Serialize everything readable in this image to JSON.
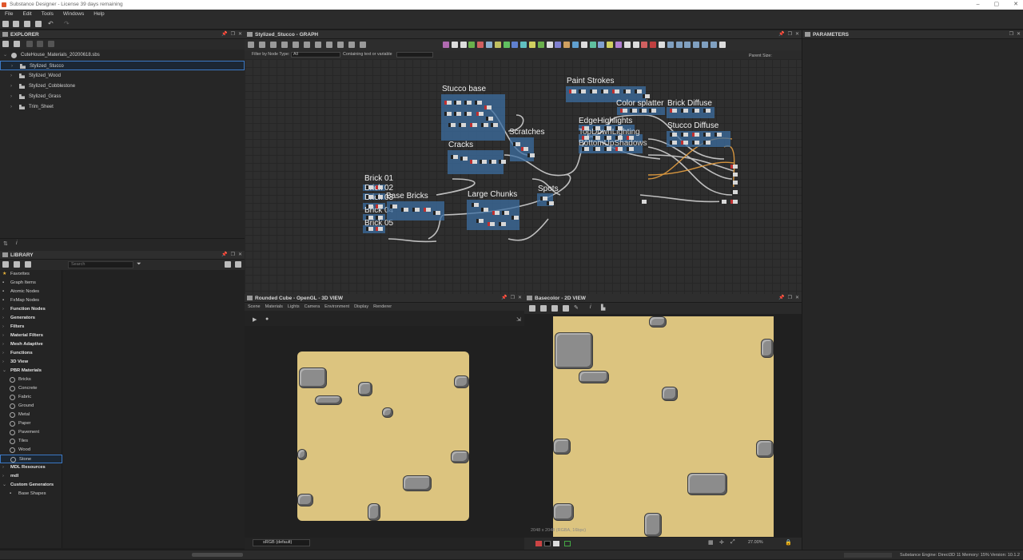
{
  "window": {
    "title": "Substance Designer - License 39 days remaining"
  },
  "menu": [
    "File",
    "Edit",
    "Tools",
    "Windows",
    "Help"
  ],
  "explorer": {
    "title": "EXPLORER",
    "file": "CuteHouse_Materials_20200618.sbs",
    "graphs": [
      "Stylized_Stucco",
      "Stylized_Wood",
      "Stylized_Cobblestone",
      "Stylized_Grass",
      "Trim_Sheet"
    ],
    "selected": "Stylized_Stucco"
  },
  "library": {
    "title": "LIBRARY",
    "search_placeholder": "Search",
    "items": [
      {
        "label": "Favorites",
        "kind": "star"
      },
      {
        "label": "Graph Items",
        "kind": "icon"
      },
      {
        "label": "Atomic Nodes",
        "kind": "icon"
      },
      {
        "label": "FxMap Nodes",
        "kind": "icon"
      },
      {
        "label": "Function Nodes",
        "kind": "bold"
      },
      {
        "label": "Generators",
        "kind": "bold"
      },
      {
        "label": "Filters",
        "kind": "bold"
      },
      {
        "label": "Material Filters",
        "kind": "bold"
      },
      {
        "label": "Mesh Adaptive",
        "kind": "bold"
      },
      {
        "label": "Functions",
        "kind": "bold"
      },
      {
        "label": "3D View",
        "kind": "bold"
      },
      {
        "label": "PBR Materials",
        "kind": "bold-open"
      },
      {
        "label": "Bricks",
        "kind": "sub"
      },
      {
        "label": "Concrete",
        "kind": "sub"
      },
      {
        "label": "Fabric",
        "kind": "sub"
      },
      {
        "label": "Ground",
        "kind": "sub"
      },
      {
        "label": "Metal",
        "kind": "sub"
      },
      {
        "label": "Paper",
        "kind": "sub"
      },
      {
        "label": "Pavement",
        "kind": "sub"
      },
      {
        "label": "Tiles",
        "kind": "sub"
      },
      {
        "label": "Wood",
        "kind": "sub"
      },
      {
        "label": "Stone",
        "kind": "sub-sel"
      },
      {
        "label": "MDL Resources",
        "kind": "bold"
      },
      {
        "label": "mdl",
        "kind": "bold"
      },
      {
        "label": "Custom Generators",
        "kind": "bold-open"
      },
      {
        "label": "Base Shapes",
        "kind": "icon-sub"
      }
    ]
  },
  "graph": {
    "title": "Stylized_Stucco - GRAPH",
    "filter_label": "Filter by Node Type:",
    "filter_value": "All",
    "containing_label": "Containing text or variable",
    "parent_size_label": "Parent Size:",
    "frames": [
      {
        "title": "Stucco base"
      },
      {
        "title": "Scratches"
      },
      {
        "title": "Cracks"
      },
      {
        "title": "Paint Strokes"
      },
      {
        "title": "Color splatter"
      },
      {
        "title": "Brick Diffuse"
      },
      {
        "title": "EdgeHighlights"
      },
      {
        "title": "TopDownLighting"
      },
      {
        "title": "BottomUpShadows"
      },
      {
        "title": "Stucco Diffuse"
      },
      {
        "title": "Brick 01"
      },
      {
        "title": "Brick 02"
      },
      {
        "title": "Brick 03"
      },
      {
        "title": "Brick 04"
      },
      {
        "title": "Brick 05"
      },
      {
        "title": "Base Bricks"
      },
      {
        "title": "Large Chunks"
      },
      {
        "title": "Spots"
      }
    ]
  },
  "view3d": {
    "title": "Rounded Cube - OpenGL - 3D VIEW",
    "menu": [
      "Scene",
      "Materials",
      "Lights",
      "Camera",
      "Environment",
      "Display",
      "Renderer"
    ],
    "colorspace": "sRGB (default)"
  },
  "view2d": {
    "title": "Basecolor - 2D VIEW",
    "resolution": "2048 x 2048 (RGBA, 16bpc)",
    "zoom": "27.00%"
  },
  "parameters": {
    "title": "PARAMETERS"
  },
  "status": {
    "text": "Substance Engine: Direct3D 11  Memory: 15%    Version: 10.1.2"
  },
  "colors": {
    "accent": "#3b78c4",
    "frame": "#3c6ea0",
    "stucco": "#dcc47f",
    "rock": "#8c8c8c"
  }
}
